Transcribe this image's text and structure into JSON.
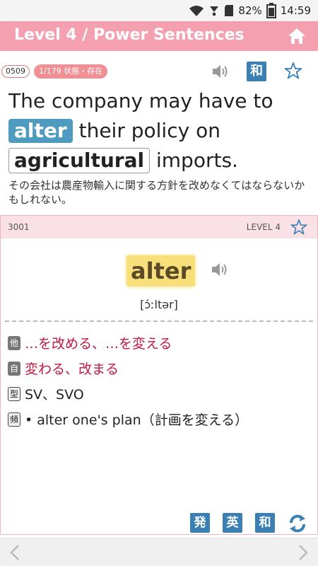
{
  "status": {
    "battery": "82%",
    "time": "14:59"
  },
  "header": {
    "title": "Level 4 / Power Sentences"
  },
  "sentence": {
    "number": "0509",
    "topic": "1/179 状態・存在",
    "part1": "The company may have to",
    "keyword": "alter",
    "part2": "their policy on",
    "phrase": "agricultural",
    "part3": "imports.",
    "translation": "その会社は農産物輸入に関する方針を改めなくてはならないかもしれない。",
    "wa_button": "和"
  },
  "card": {
    "number": "3001",
    "level": "LEVEL 4",
    "word": "alter",
    "phonetic": "[ɔ́ːltər]",
    "definitions": [
      {
        "tag": "他",
        "text": "…を改める、…を変える",
        "color": "red"
      },
      {
        "tag": "自",
        "text": "変わる、改まる",
        "color": "red"
      },
      {
        "tag": "型",
        "text": "SV、SVO",
        "color": "dark"
      },
      {
        "tag": "頻",
        "text": "•  alter one's plan（計画を変える）",
        "color": "dark"
      }
    ],
    "buttons": [
      "発",
      "英",
      "和"
    ]
  },
  "colors": {
    "accent": "#f4a0b1",
    "button": "#3b80b5",
    "keyword": "#4f9bbf",
    "highlight": "#f7e07c",
    "red": "#c0183f"
  },
  "icons": [
    "wifi-icon",
    "signal-icon",
    "battery-icon",
    "home-icon",
    "speaker-icon",
    "star-icon",
    "refresh-icon",
    "chevron-left-icon",
    "chevron-right-icon"
  ]
}
